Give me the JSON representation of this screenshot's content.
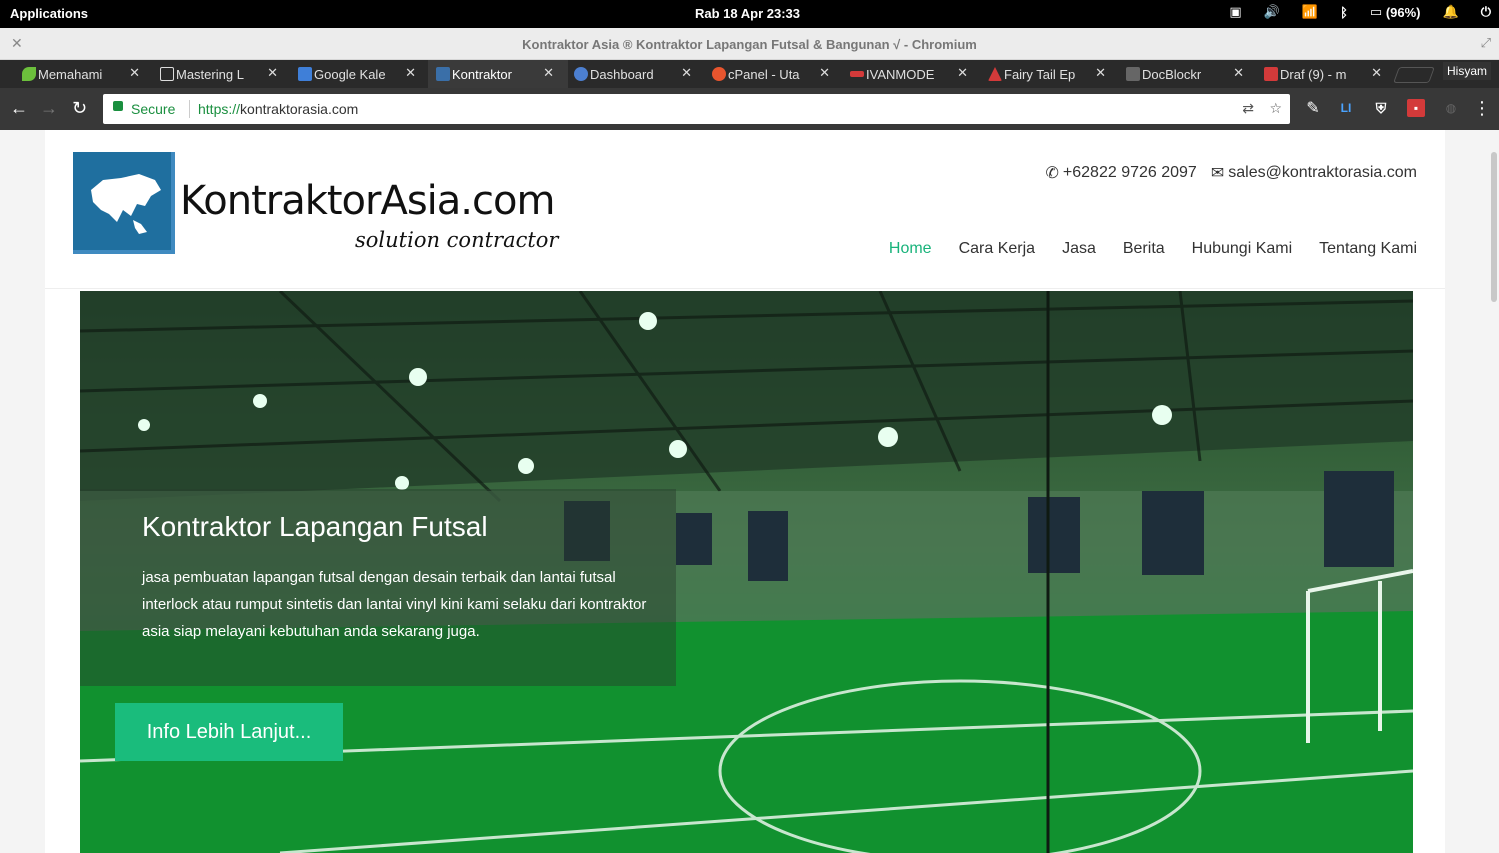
{
  "system_bar": {
    "applications_label": "Applications",
    "datetime": "Rab 18 Apr   23:33",
    "battery": "(96%)"
  },
  "window": {
    "title": "Kontraktor Asia ® Kontraktor Lapangan Futsal & Bangunan √ - Chromium"
  },
  "tabs": [
    {
      "label": "Memahami",
      "favicon_color": "#6cbf3c"
    },
    {
      "label": "Mastering L",
      "favicon_color": "#dddddd"
    },
    {
      "label": "Google Kale",
      "favicon_color": "#3f7fd8"
    },
    {
      "label": "Kontraktor",
      "favicon_color": "#3a6fa8"
    },
    {
      "label": "Dashboard",
      "favicon_color": "#4c7fd0"
    },
    {
      "label": "cPanel - Uta",
      "favicon_color": "#e8552e"
    },
    {
      "label": "IVANMODE",
      "favicon_color": "#d33a3a"
    },
    {
      "label": "Fairy Tail Ep",
      "favicon_color": "#d33a3a"
    },
    {
      "label": "DocBlockr",
      "favicon_color": "#666666"
    },
    {
      "label": "Draf (9) - m",
      "favicon_color": "#d33a3a"
    }
  ],
  "user_label": "Hisyam",
  "omnibox": {
    "secure_label": "Secure",
    "url_protocol": "https://",
    "url_host": "kontraktorasia.com"
  },
  "site": {
    "logo_name": "KontraktorAsia.com",
    "tagline": "solution contractor",
    "phone": "+62822 9726 2097",
    "email": "sales@kontraktorasia.com",
    "nav": [
      {
        "label": "Home",
        "active": true
      },
      {
        "label": "Cara Kerja",
        "active": false
      },
      {
        "label": "Jasa",
        "active": false
      },
      {
        "label": "Berita",
        "active": false
      },
      {
        "label": "Hubungi Kami",
        "active": false
      },
      {
        "label": "Tentang Kami",
        "active": false
      }
    ],
    "hero": {
      "title": "Kontraktor Lapangan Futsal",
      "text": "jasa pembuatan lapangan futsal dengan desain terbaik dan lantai futsal interlock atau rumput sintetis dan lantai vinyl kini kami selaku dari kontraktor asia siap melayani kebutuhan anda sekarang juga.",
      "cta_label": "Info Lebih Lanjut..."
    }
  },
  "colors": {
    "accent": "#1abc7c",
    "logo_blue": "#1f6f9f",
    "secure_green": "#1a8f3f"
  }
}
